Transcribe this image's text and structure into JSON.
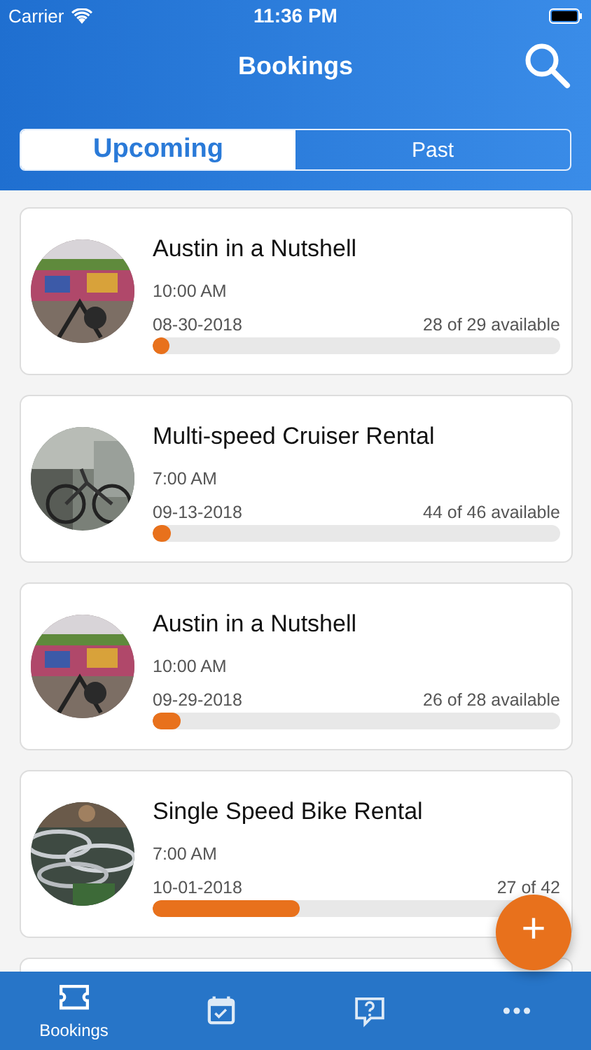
{
  "status_bar": {
    "carrier": "Carrier",
    "time": "11:36 PM"
  },
  "header": {
    "title": "Bookings"
  },
  "segments": [
    {
      "label": "Upcoming",
      "selected": true
    },
    {
      "label": "Past",
      "selected": false
    }
  ],
  "bookings": [
    {
      "title": "Austin in a Nutshell",
      "time": "10:00 AM",
      "date": "08-30-2018",
      "availability": "28 of 29 available",
      "level": 0.04
    },
    {
      "title": "Multi-speed Cruiser Rental",
      "time": "7:00 AM",
      "date": "09-13-2018",
      "availability": "44 of 46 available",
      "level": 0.045
    },
    {
      "title": "Austin in a Nutshell",
      "time": "10:00 AM",
      "date": "09-29-2018",
      "availability": "26 of 28 available",
      "level": 0.07
    },
    {
      "title": "Single Speed Bike Rental",
      "time": "7:00 AM",
      "date": "10-01-2018",
      "availability": "27 of 42",
      "level": 0.36
    }
  ],
  "fab": {
    "symbol": "+"
  },
  "tab_bar": [
    {
      "kind": "ticket",
      "label": "Bookings",
      "selected": true
    },
    {
      "kind": "calendar",
      "selected": false
    },
    {
      "kind": "help",
      "selected": false
    },
    {
      "kind": "more",
      "selected": false
    }
  ]
}
